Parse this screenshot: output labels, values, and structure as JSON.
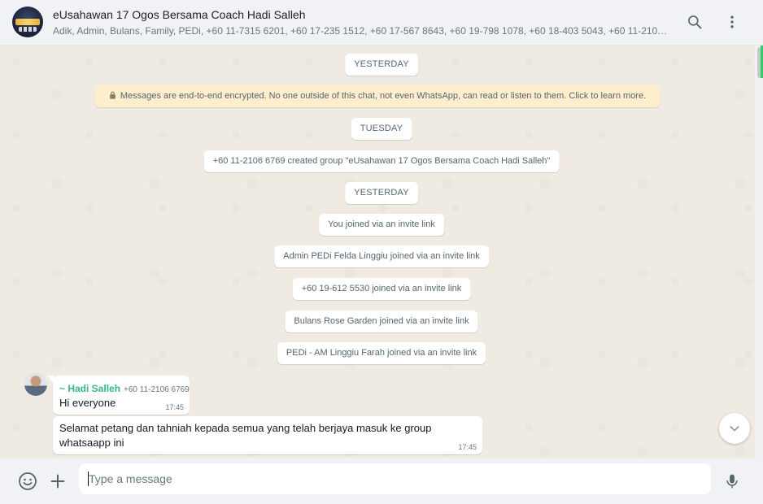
{
  "header": {
    "title": "eUsahawan 17 Ogos Bersama Coach Hadi Salleh",
    "members": "Adik, Admin, Bulans, Family, PEDi, +60 11-7315 6201, +60 17-235 1512, +60 17-567 8643, +60 19-798 1078, +60 18-403 5043, +60 11-2106 676..."
  },
  "icons": {
    "search": "search-icon",
    "menu": "more-vertical-icon",
    "lock": "lock-icon",
    "emoji": "emoji-icon",
    "attach": "plus-icon",
    "mic": "microphone-icon",
    "scroll": "chevron-down-icon"
  },
  "colors": {
    "accent": "#25d366",
    "sender": "#35b58e",
    "encryption_bg": "#ffeecd",
    "chat_bg": "#efeae2"
  },
  "chat": {
    "date1": "YESTERDAY",
    "encryption": "Messages are end-to-end encrypted. No one outside of this chat, not even WhatsApp, can read or listen to them. Click to learn more.",
    "date2": "TUESDAY",
    "created": "+60 11-2106 6769 created group \"eUsahawan 17 Ogos Bersama Coach Hadi Salleh\"",
    "date3": "YESTERDAY",
    "joins": [
      "You joined via an invite link",
      "Admin PEDi Felda Linggiu joined via an invite link",
      "+60 19-612 5530 joined via an invite link",
      "Bulans Rose Garden joined via an invite link",
      "PEDi - AM Linggiu Farah joined via an invite link"
    ],
    "messages": [
      {
        "sender": "~ Hadi Salleh",
        "phone": "+60 11-2106 6769",
        "text": "Hi everyone",
        "time": "17:45"
      },
      {
        "text": "Selamat petang dan tahniah kepada semua yang telah berjaya masuk ke group whatsaapp ini",
        "time": "17:45"
      }
    ]
  },
  "composer": {
    "placeholder": "Type a message"
  }
}
